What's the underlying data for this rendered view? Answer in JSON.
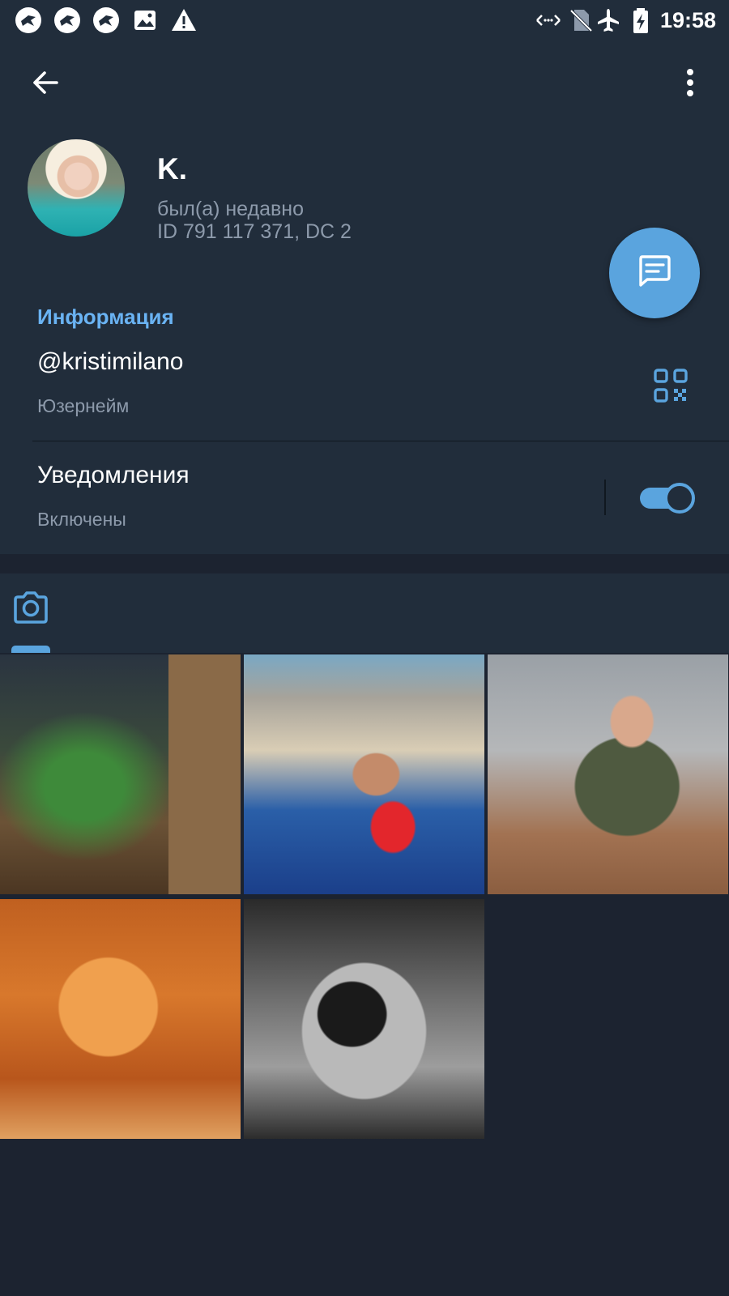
{
  "status_bar": {
    "time": "19:58",
    "left_icons": [
      "bird-app-icon",
      "bird-app-icon",
      "bird-app-icon",
      "image-icon",
      "warning-icon"
    ],
    "right_icons": [
      "data-arrows-icon",
      "no-sim-icon",
      "airplane-icon",
      "battery-charging-icon"
    ]
  },
  "toolbar": {
    "back_icon": "arrow-left-icon",
    "menu_icon": "more-vertical-icon"
  },
  "profile": {
    "name": "K.",
    "status": "был(а) недавно",
    "id_line": "ID 791 117 371, DC 2",
    "message_icon": "message-icon"
  },
  "info": {
    "title": "Информация",
    "username": "@kristimilano",
    "username_label": "Юзернейм",
    "qr_icon": "qr-code-icon",
    "notifications": "Уведомления",
    "notifications_state": "Включены",
    "notifications_enabled": true
  },
  "media": {
    "tab_icon": "camera-icon",
    "photos": [
      {
        "subject": "sauna-relax-photo"
      },
      {
        "subject": "pool-man-photo"
      },
      {
        "subject": "man-laptop-photo"
      },
      {
        "subject": "woman-harness-photo"
      },
      {
        "subject": "woman-lingerie-photo"
      }
    ]
  },
  "colors": {
    "background": "#1c2330",
    "surface": "#212d3b",
    "accent": "#5aa4de",
    "link": "#6ab3f3",
    "secondary_text": "#8d9aab"
  }
}
